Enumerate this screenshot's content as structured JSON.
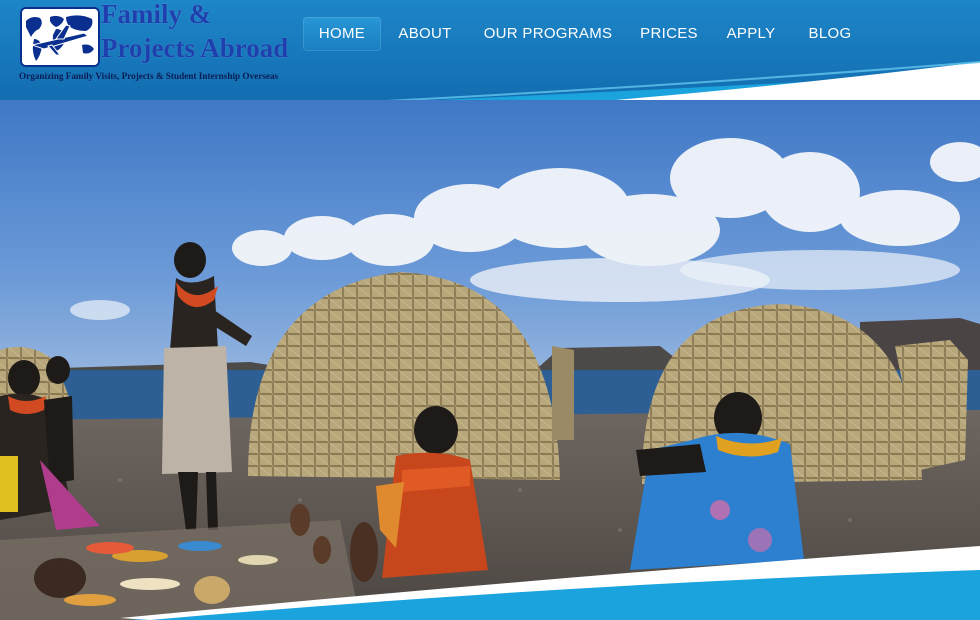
{
  "brand": {
    "title_line1": "Family &",
    "title_line2": "Projects Abroad",
    "tagline": "Organizing Family Visits, Projects & Student Internship Overseas",
    "logo_icon": "airplane-globe-icon",
    "title_color": "#1f3fae"
  },
  "nav": {
    "items": [
      {
        "label": "HOME",
        "active": true
      },
      {
        "label": "ABOUT",
        "active": false
      },
      {
        "label": "OUR PROGRAMS",
        "active": false
      },
      {
        "label": "PRICES",
        "active": false
      },
      {
        "label": "APPLY",
        "active": false
      },
      {
        "label": "BLOG",
        "active": false
      }
    ]
  },
  "hero": {
    "subject": "traditional dome huts by a lake with seated and standing people"
  },
  "colors": {
    "header_blue": "#1470b3",
    "accent_cyan": "#1aa3dc",
    "nav_text": "#ffffff"
  }
}
